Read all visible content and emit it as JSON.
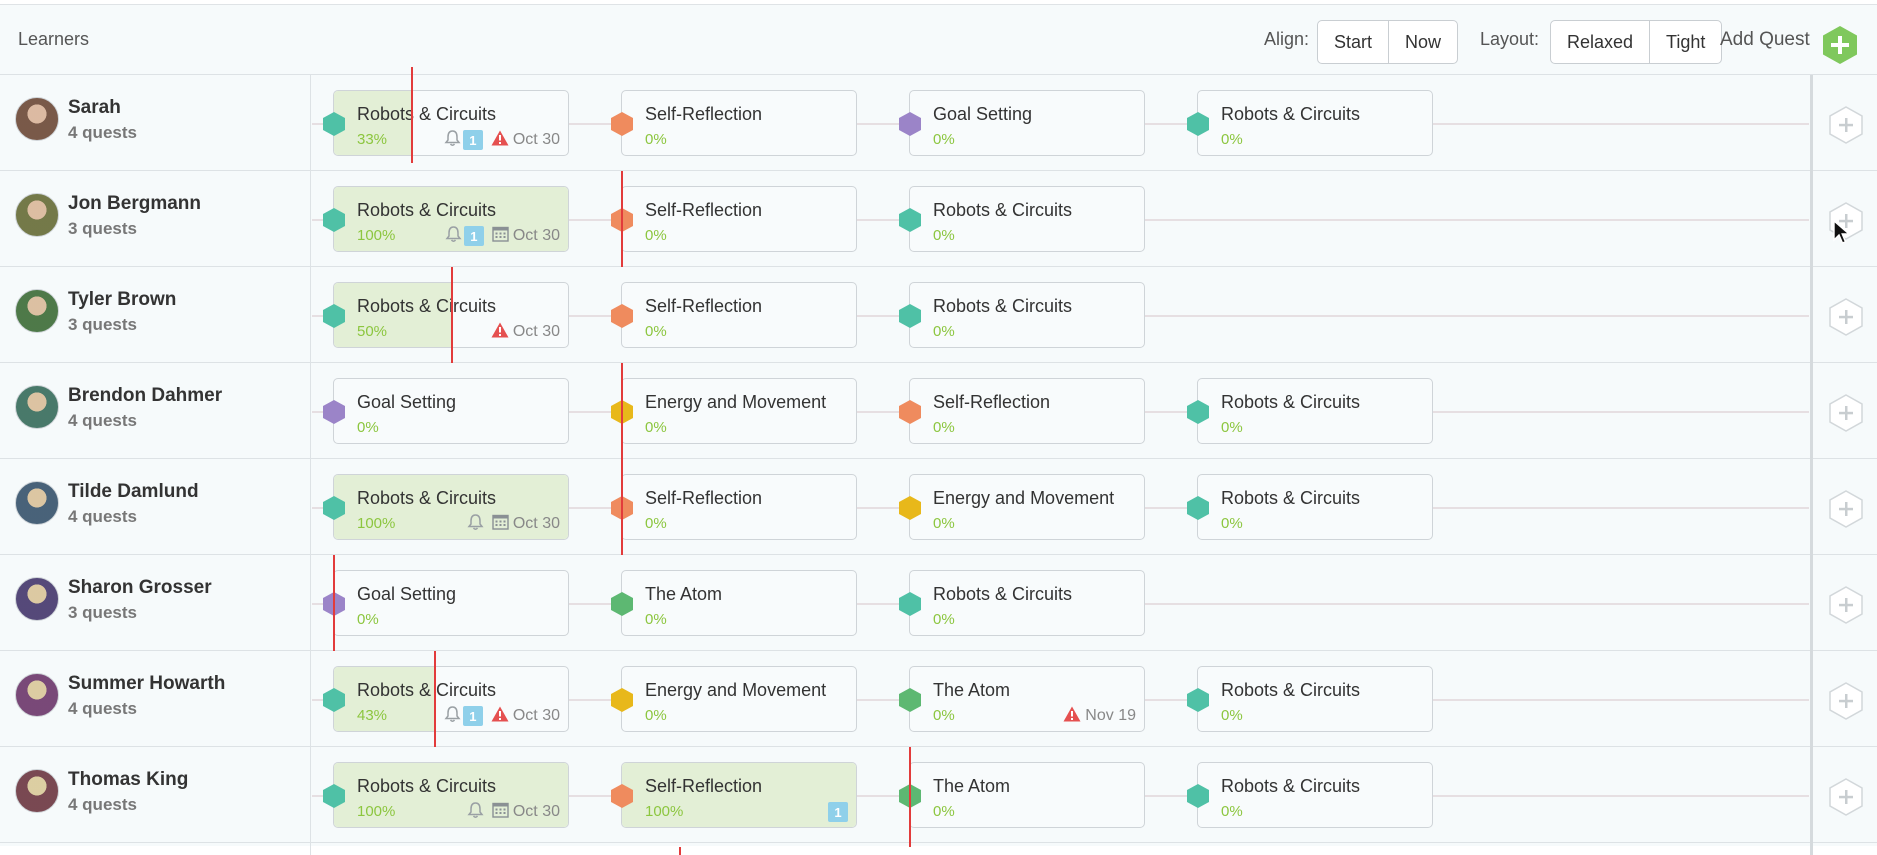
{
  "header": {
    "title": "Learners",
    "align_label": "Align:",
    "align_options": [
      "Start",
      "Now"
    ],
    "layout_label": "Layout:",
    "layout_options": [
      "Relaxed",
      "Tight"
    ],
    "add_quest_label": "Add Quest"
  },
  "colors": {
    "teal": "#4fc1a6",
    "orange": "#ef8b5e",
    "purple": "#9b84c8",
    "yellow": "#e8b81a",
    "green": "#5db872",
    "progress_text": "#8cc63f",
    "progress_fill": "#e3efd6",
    "now_line": "#e23b3b",
    "badge": "#8fd0ea",
    "warning": "#e55050"
  },
  "learners": [
    {
      "name": "Sarah",
      "count": "4 quests",
      "now_line_at": 0.33,
      "quests": [
        {
          "title": "Robots & Circuits",
          "color": "teal",
          "progress": "33%",
          "progress_value": 0.33,
          "bell": true,
          "badge": "1",
          "due_icon": "warning",
          "due": "Oct 30"
        },
        {
          "title": "Self-Reflection",
          "color": "orange",
          "progress": "0%",
          "progress_value": 0
        },
        {
          "title": "Goal Setting",
          "color": "purple",
          "progress": "0%",
          "progress_value": 0
        },
        {
          "title": "Robots & Circuits",
          "color": "teal",
          "progress": "0%",
          "progress_value": 0
        }
      ]
    },
    {
      "name": "Jon Bergmann",
      "count": "3 quests",
      "now_line_at": 1.0,
      "quests": [
        {
          "title": "Robots & Circuits",
          "color": "teal",
          "progress": "100%",
          "progress_value": 1,
          "bell": true,
          "badge": "1",
          "due_icon": "calendar",
          "due": "Oct 30"
        },
        {
          "title": "Self-Reflection",
          "color": "orange",
          "progress": "0%",
          "progress_value": 0
        },
        {
          "title": "Robots & Circuits",
          "color": "teal",
          "progress": "0%",
          "progress_value": 0
        }
      ]
    },
    {
      "name": "Tyler Brown",
      "count": "3 quests",
      "now_line_at": 0.5,
      "quests": [
        {
          "title": "Robots & Circuits",
          "color": "teal",
          "progress": "50%",
          "progress_value": 0.5,
          "due_icon": "warning",
          "due": "Oct 30"
        },
        {
          "title": "Self-Reflection",
          "color": "orange",
          "progress": "0%",
          "progress_value": 0
        },
        {
          "title": "Robots & Circuits",
          "color": "teal",
          "progress": "0%",
          "progress_value": 0
        }
      ]
    },
    {
      "name": "Brendon Dahmer",
      "count": "4 quests",
      "now_line_at": 1.0,
      "quests": [
        {
          "title": "Goal Setting",
          "color": "purple",
          "progress": "0%",
          "progress_value": 0
        },
        {
          "title": "Energy and Movement",
          "color": "yellow",
          "progress": "0%",
          "progress_value": 0
        },
        {
          "title": "Self-Reflection",
          "color": "orange",
          "progress": "0%",
          "progress_value": 0
        },
        {
          "title": "Robots & Circuits",
          "color": "teal",
          "progress": "0%",
          "progress_value": 0
        }
      ]
    },
    {
      "name": "Tilde Damlund",
      "count": "4 quests",
      "now_line_at": 1.0,
      "quests": [
        {
          "title": "Robots & Circuits",
          "color": "teal",
          "progress": "100%",
          "progress_value": 1,
          "bell": true,
          "due_icon": "calendar",
          "due": "Oct 30"
        },
        {
          "title": "Self-Reflection",
          "color": "orange",
          "progress": "0%",
          "progress_value": 0
        },
        {
          "title": "Energy and Movement",
          "color": "yellow",
          "progress": "0%",
          "progress_value": 0
        },
        {
          "title": "Robots & Circuits",
          "color": "teal",
          "progress": "0%",
          "progress_value": 0
        }
      ]
    },
    {
      "name": "Sharon Grosser",
      "count": "3 quests",
      "now_line_at": 0.0,
      "quests": [
        {
          "title": "Goal Setting",
          "color": "purple",
          "progress": "0%",
          "progress_value": 0
        },
        {
          "title": "The Atom",
          "color": "green",
          "progress": "0%",
          "progress_value": 0
        },
        {
          "title": "Robots & Circuits",
          "color": "teal",
          "progress": "0%",
          "progress_value": 0
        }
      ]
    },
    {
      "name": "Summer Howarth",
      "count": "4 quests",
      "now_line_at": 0.43,
      "quests": [
        {
          "title": "Robots & Circuits",
          "color": "teal",
          "progress": "43%",
          "progress_value": 0.43,
          "bell": true,
          "badge": "1",
          "due_icon": "warning",
          "due": "Oct 30"
        },
        {
          "title": "Energy and Movement",
          "color": "yellow",
          "progress": "0%",
          "progress_value": 0
        },
        {
          "title": "The Atom",
          "color": "green",
          "progress": "0%",
          "progress_value": 0,
          "due_icon": "warning",
          "due": "Nov 19"
        },
        {
          "title": "Robots & Circuits",
          "color": "teal",
          "progress": "0%",
          "progress_value": 0
        }
      ]
    },
    {
      "name": "Thomas King",
      "count": "4 quests",
      "now_line_at": 2.0,
      "quests": [
        {
          "title": "Robots & Circuits",
          "color": "teal",
          "progress": "100%",
          "progress_value": 1,
          "bell": true,
          "due_icon": "calendar",
          "due": "Oct 30"
        },
        {
          "title": "Self-Reflection",
          "color": "orange",
          "progress": "100%",
          "progress_value": 1,
          "badge": "1"
        },
        {
          "title": "The Atom",
          "color": "green",
          "progress": "0%",
          "progress_value": 0
        },
        {
          "title": "Robots & Circuits",
          "color": "teal",
          "progress": "0%",
          "progress_value": 0
        }
      ]
    }
  ]
}
